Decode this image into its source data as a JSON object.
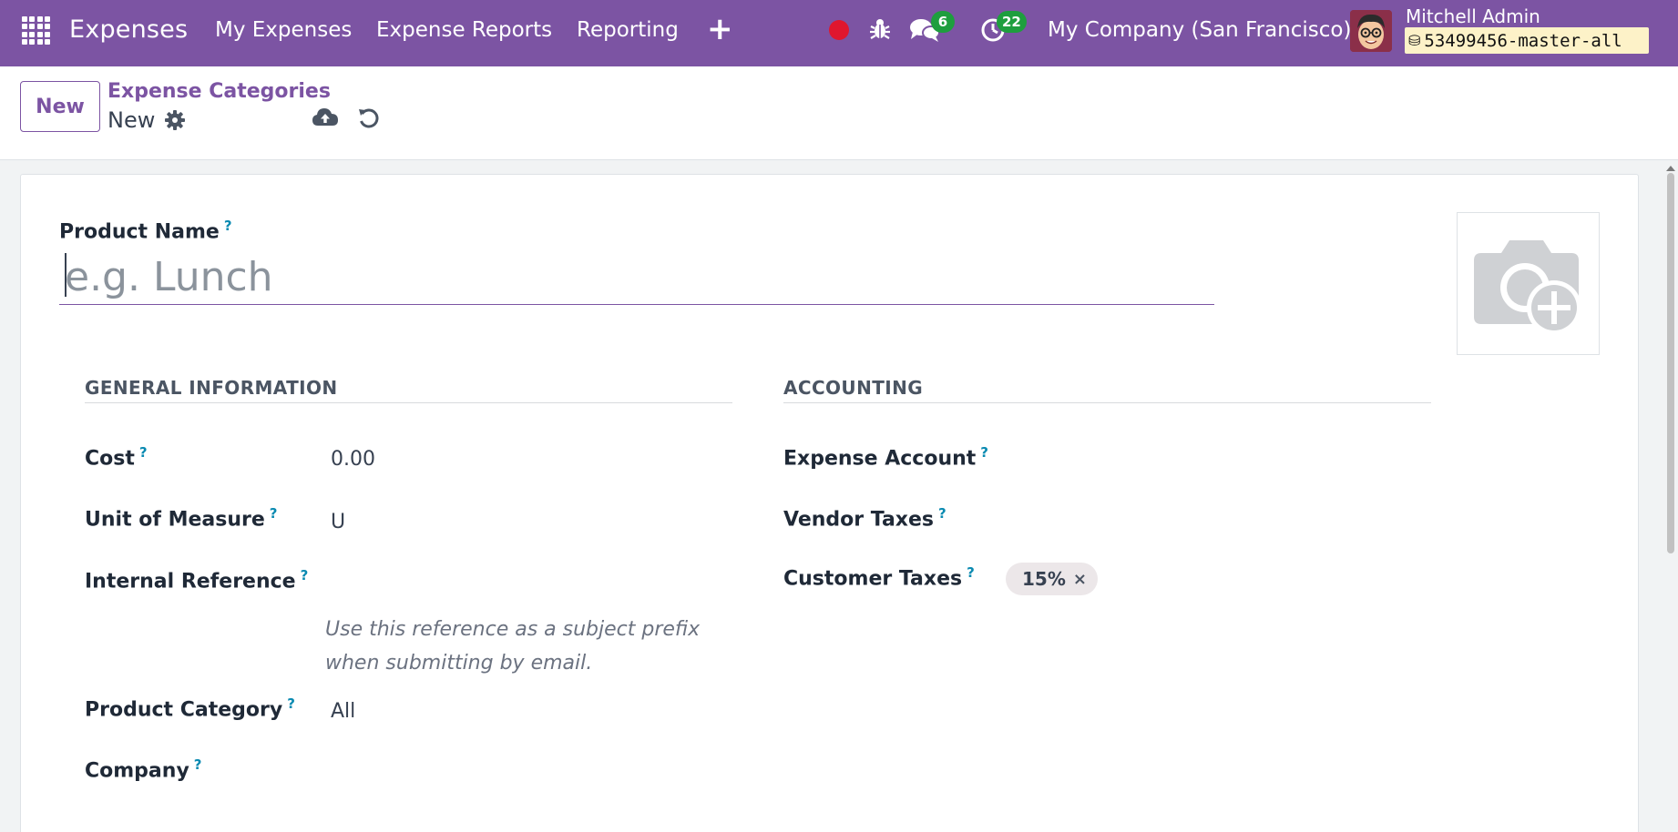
{
  "navbar": {
    "app_name": "Expenses",
    "menu": [
      "My Expenses",
      "Expense Reports",
      "Reporting"
    ],
    "plus": "+",
    "messages_count": "6",
    "activities_count": "22",
    "company": "My Company (San Francisco)",
    "user_name": "Mitchell Admin",
    "database": "53499456-master-all",
    "accent_color": "#7c54a3"
  },
  "control_panel": {
    "new_button": "New",
    "breadcrumb_parent": "Expense Categories",
    "breadcrumb_current": "New"
  },
  "form": {
    "product_name_label": "Product Name",
    "product_name_placeholder": "e.g. Lunch",
    "help_mark": "?",
    "general_section": "GENERAL INFORMATION",
    "accounting_section": "ACCOUNTING",
    "cost_label": "Cost",
    "cost_value": "0.00",
    "uom_label": "Unit of Measure",
    "uom_value": "U",
    "internal_reference_label": "Internal Reference",
    "internal_reference_help": "Use this reference as a subject prefix when submitting by email.",
    "product_category_label": "Product Category",
    "product_category_value": "All",
    "company_label": "Company",
    "expense_account_label": "Expense Account",
    "vendor_taxes_label": "Vendor Taxes",
    "customer_taxes_label": "Customer Taxes",
    "customer_taxes_tag": "15%",
    "tag_remove": "×"
  }
}
